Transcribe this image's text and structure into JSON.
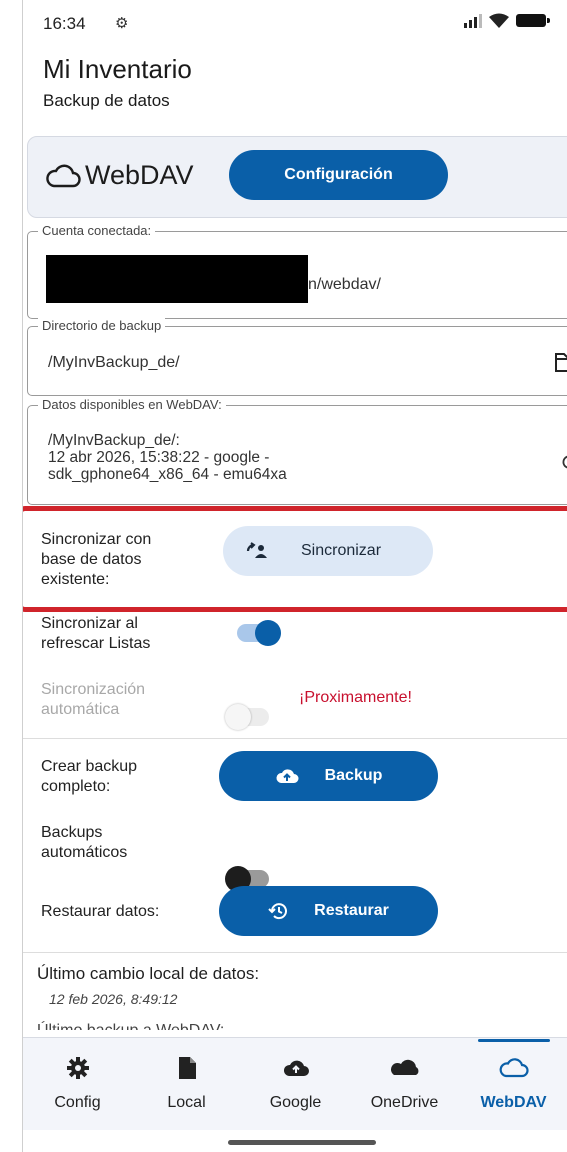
{
  "status_bar": {
    "time": "16:34"
  },
  "app": {
    "title": "Mi Inventario",
    "subtitle": "Backup de datos"
  },
  "provider": {
    "name": "WebDAV",
    "config_label": "Configuración"
  },
  "account": {
    "legend": "Cuenta conectada:",
    "value_suffix": "n/webdav/"
  },
  "backup_dir": {
    "legend": "Directorio de backup",
    "value": "/MyInvBackup_de/"
  },
  "available_data": {
    "legend": "Datos disponibles en WebDAV:",
    "line1": "/MyInvBackup_de/:",
    "line2": "12 abr 2026, 15:38:22 - google -",
    "line3": "sdk_gphone64_x86_64 - emu64xa"
  },
  "sync_existing": {
    "label_l1": "Sincronizar con",
    "label_l2": "base de datos",
    "label_l3": "existente:",
    "button": "Sincronizar"
  },
  "sync_on_refresh": {
    "label_l1": "Sincronizar al",
    "label_l2": "refrescar Listas",
    "state": "on"
  },
  "auto_sync": {
    "label_l1": "Sincronización",
    "label_l2": "automática",
    "state": "disabled",
    "soon": "¡Proximamente!"
  },
  "full_backup": {
    "label_l1": "Crear backup",
    "label_l2": "completo:",
    "button": "Backup"
  },
  "auto_backups": {
    "label_l1": "Backups",
    "label_l2": "automáticos",
    "state": "off"
  },
  "restore": {
    "label": "Restaurar datos:",
    "button": "Restaurar"
  },
  "last_change": {
    "label": "Último cambio local de datos:",
    "value": "12 feb 2026, 8:49:12"
  },
  "last_backup": {
    "label": "Último backup a WebDAV:"
  },
  "bottom_nav": {
    "items": [
      {
        "label": "Config",
        "icon": "gear-icon"
      },
      {
        "label": "Local",
        "icon": "file-icon"
      },
      {
        "label": "Google",
        "icon": "cloud-upload-icon"
      },
      {
        "label": "OneDrive",
        "icon": "cloud-filled-icon"
      },
      {
        "label": "WebDAV",
        "icon": "cloud-outline-icon"
      }
    ],
    "active": "WebDAV"
  },
  "colors": {
    "primary": "#0a5fa8",
    "highlight": "#d0242b",
    "soon": "#c8102e",
    "tonal": "#dde8f6"
  }
}
